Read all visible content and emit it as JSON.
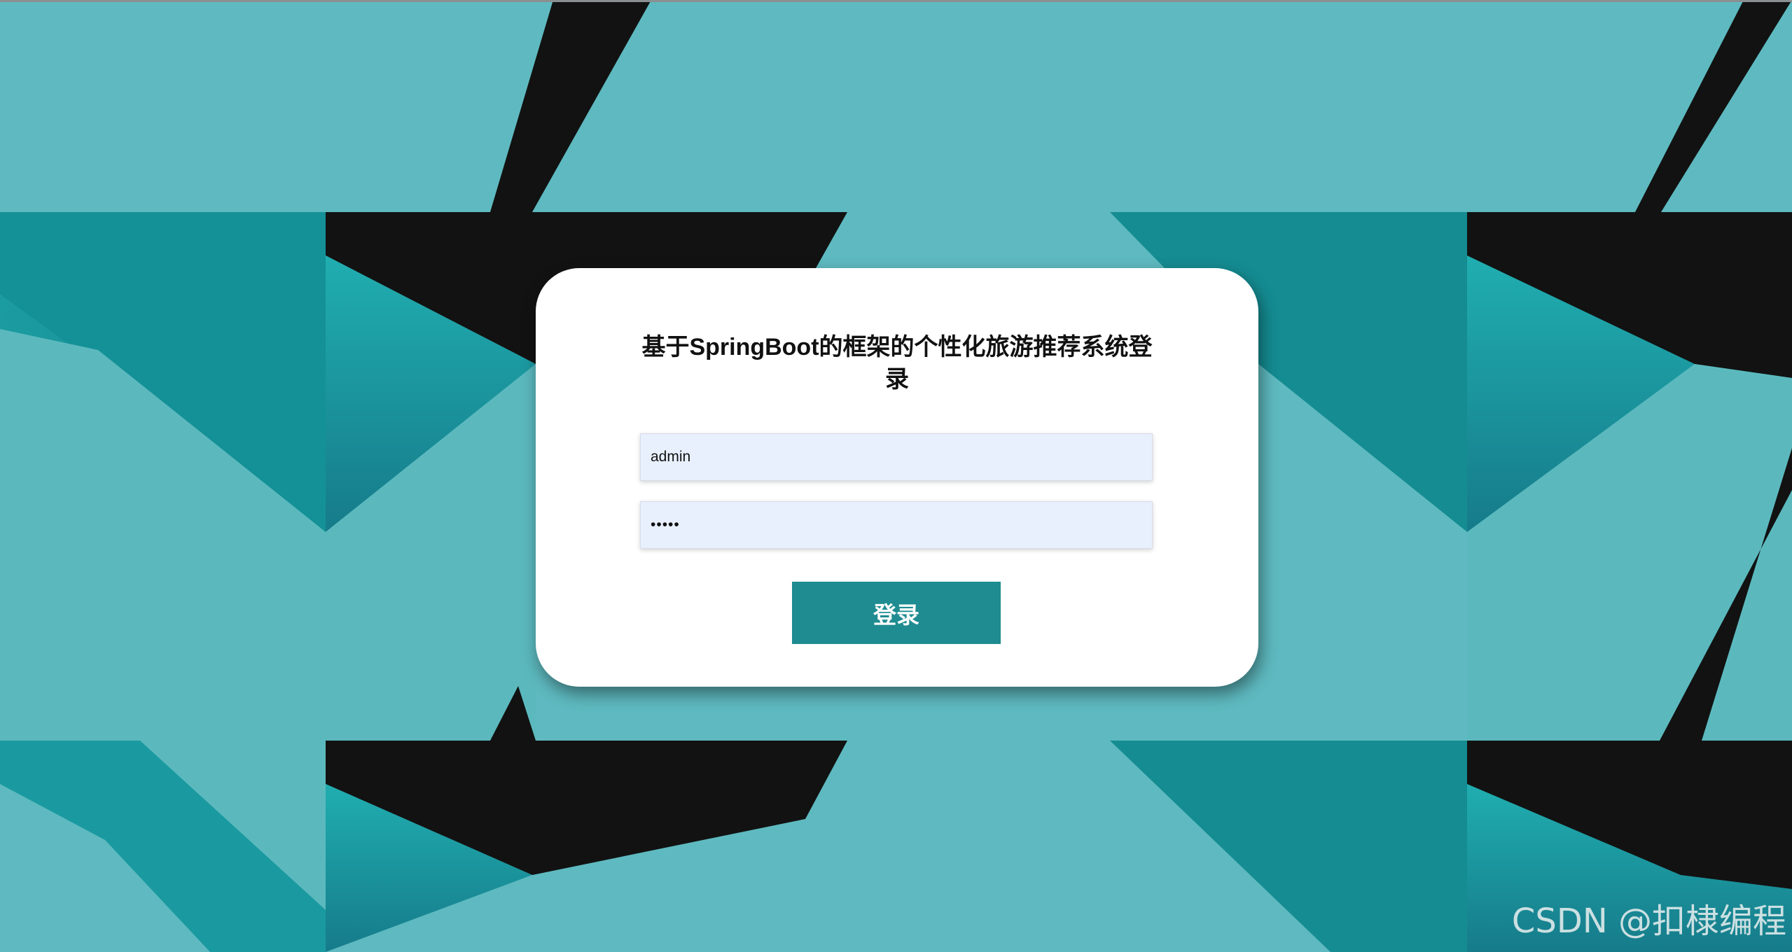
{
  "login": {
    "title": "基于SpringBoot的框架的个性化旅游推荐系统登录",
    "username_value": "admin",
    "password_value": "•••••",
    "submit_label": "登录"
  },
  "watermark": "CSDN @扣棣编程",
  "colors": {
    "teal_light": "#5ebac0",
    "teal_dark": "#1a8d92",
    "black": "#121212",
    "button": "#1e8c90",
    "input_bg": "#e8f0fe"
  }
}
